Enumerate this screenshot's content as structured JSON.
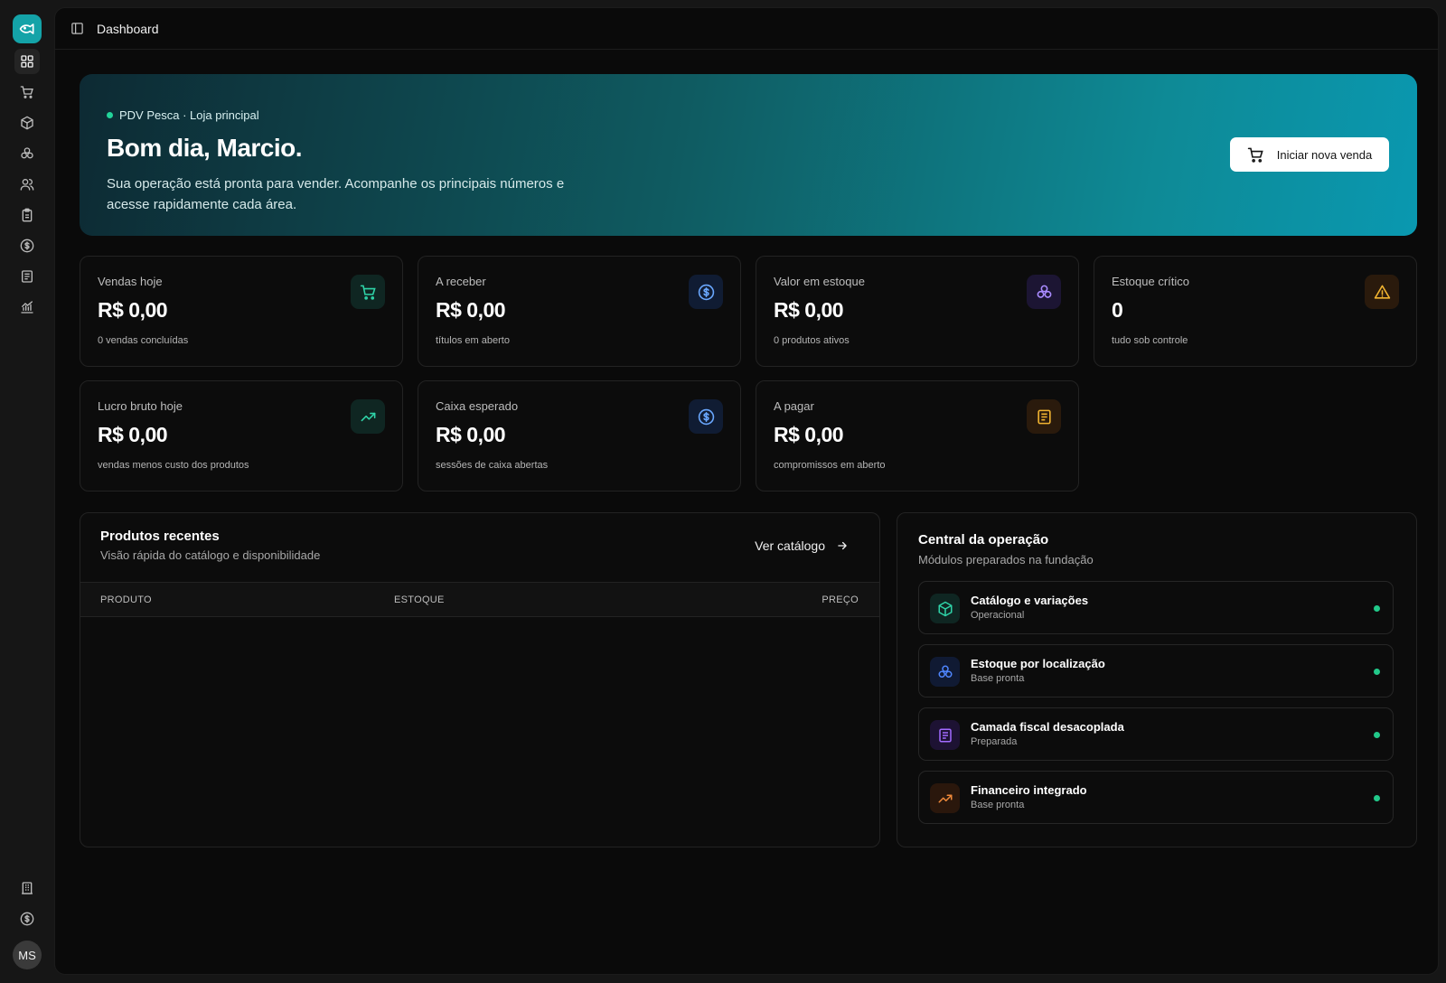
{
  "header": {
    "breadcrumb": "Dashboard"
  },
  "sidebar": {
    "items": [
      {
        "icon": "dashboard-icon"
      },
      {
        "icon": "cart-icon"
      },
      {
        "icon": "package-icon"
      },
      {
        "icon": "boxes-icon"
      },
      {
        "icon": "users-icon"
      },
      {
        "icon": "clipboard-icon"
      },
      {
        "icon": "dollar-icon"
      },
      {
        "icon": "receipt-icon"
      },
      {
        "icon": "chart-icon"
      }
    ],
    "bottom": [
      {
        "icon": "building-icon"
      },
      {
        "icon": "dollar-icon"
      }
    ],
    "avatar": "MS"
  },
  "hero": {
    "tag": "PDV Pesca · Loja principal",
    "greeting": "Bom dia, Marcio.",
    "description": "Sua operação está pronta para vender. Acompanhe os principais números e acesse rapidamente cada área.",
    "cta": "Iniciar nova venda"
  },
  "stats": [
    {
      "label": "Vendas hoje",
      "value": "R$ 0,00",
      "sub": "0 vendas concluídas",
      "icon": "cart-icon",
      "color": "#2fd3a8"
    },
    {
      "label": "A receber",
      "value": "R$ 0,00",
      "sub": "títulos em aberto",
      "icon": "dollar-icon",
      "color": "#6aa8ff"
    },
    {
      "label": "Valor em estoque",
      "value": "R$ 0,00",
      "sub": "0 produtos ativos",
      "icon": "boxes-icon",
      "color": "#a98bff"
    },
    {
      "label": "Estoque crítico",
      "value": "0",
      "sub": "tudo sob controle",
      "icon": "alert-icon",
      "color": "#f2b431"
    },
    {
      "label": "Lucro bruto hoje",
      "value": "R$ 0,00",
      "sub": "vendas menos custo dos produtos",
      "icon": "trending-up-icon",
      "color": "#2fd3a8"
    },
    {
      "label": "Caixa esperado",
      "value": "R$ 0,00",
      "sub": "sessões de caixa abertas",
      "icon": "dollar-icon",
      "color": "#6aa8ff"
    },
    {
      "label": "A pagar",
      "value": "R$ 0,00",
      "sub": "compromissos em aberto",
      "icon": "receipt-icon",
      "color": "#f2b431"
    }
  ],
  "recent": {
    "title": "Produtos recentes",
    "subtitle": "Visão rápida do catálogo e disponibilidade",
    "link": "Ver catálogo",
    "columns": [
      "PRODUTO",
      "ESTOQUE",
      "PREÇO"
    ],
    "rows": []
  },
  "central": {
    "title": "Central da operação",
    "subtitle": "Módulos preparados na fundação",
    "modules": [
      {
        "title": "Catálogo e variações",
        "status": "Operacional",
        "icon": "package-icon",
        "color": "#2fd3a8"
      },
      {
        "title": "Estoque por localização",
        "status": "Base pronta",
        "icon": "boxes-icon",
        "color": "#4f86ff"
      },
      {
        "title": "Camada fiscal desacoplada",
        "status": "Preparada",
        "icon": "receipt-icon",
        "color": "#a26bff"
      },
      {
        "title": "Financeiro integrado",
        "status": "Base pronta",
        "icon": "trending-up-icon",
        "color": "#f08a3a"
      }
    ]
  }
}
